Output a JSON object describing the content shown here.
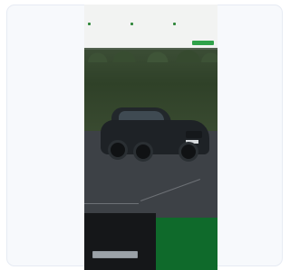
{
  "cookie_banner": {
    "title": "",
    "options": [
      {
        "label": "",
        "description": ""
      },
      {
        "label": "",
        "description": ""
      },
      {
        "label": "",
        "description": ""
      }
    ],
    "buttons": {
      "link": "",
      "secondary": "",
      "accept": ""
    }
  },
  "hero": {
    "image": "car-photo"
  },
  "promo_dark": {
    "text": "",
    "button": ""
  },
  "promo_green": {
    "title": "",
    "text": "",
    "link": ""
  },
  "colors": {
    "accent": "#2ea84a",
    "green_panel": "#0f6a2b",
    "dark_panel": "#151719"
  }
}
